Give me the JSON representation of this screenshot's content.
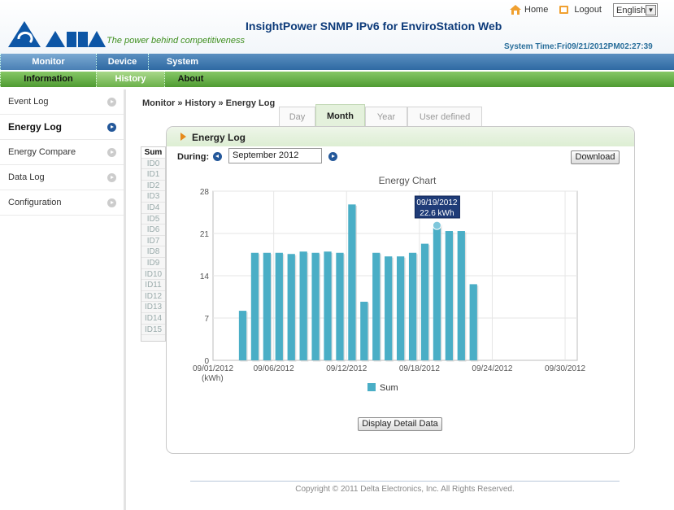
{
  "header": {
    "tagline": "The power behind competitiveness",
    "title": "InsightPower SNMP IPv6 for EnviroStation Web",
    "home_label": "Home",
    "logout_label": "Logout",
    "language": "English",
    "system_time": "System Time:Fri09/21/2012PM02:27:39",
    "brand_colors": {
      "blue": "#0d56a6",
      "green": "#3f8f1f"
    }
  },
  "nav_primary": [
    {
      "label": "Monitor",
      "active": true
    },
    {
      "label": "Device",
      "active": false
    },
    {
      "label": "System",
      "active": false
    }
  ],
  "nav_secondary": [
    {
      "label": "Information",
      "active": false
    },
    {
      "label": "History",
      "active": true
    },
    {
      "label": "About",
      "active": false
    }
  ],
  "sidebar": {
    "items": [
      {
        "label": "Event Log",
        "active": false
      },
      {
        "label": "Energy Log",
        "active": true
      },
      {
        "label": "Energy Compare",
        "active": false
      },
      {
        "label": "Data Log",
        "active": false
      },
      {
        "label": "Configuration",
        "active": false
      }
    ]
  },
  "breadcrumb": "Monitor » History » Energy Log",
  "tabs": [
    {
      "label": "Day",
      "active": false
    },
    {
      "label": "Month",
      "active": true
    },
    {
      "label": "Year",
      "active": false
    },
    {
      "label": "User defined",
      "active": false
    }
  ],
  "panel": {
    "title": "Energy Log",
    "during_label": "During:",
    "period_value": "September 2012",
    "download_label": "Download",
    "detail_button": "Display Detail Data"
  },
  "id_list": [
    "Sum",
    "ID0",
    "ID1",
    "ID2",
    "ID3",
    "ID4",
    "ID5",
    "ID6",
    "ID7",
    "ID8",
    "ID9",
    "ID10",
    "ID11",
    "ID12",
    "ID13",
    "ID14",
    "ID15"
  ],
  "chart_data": {
    "type": "bar",
    "title": "Energy Chart",
    "xlabel": "(kWh)",
    "x_ticks": [
      "09/01/2012",
      "09/06/2012",
      "09/12/2012",
      "09/18/2012",
      "09/24/2012",
      "09/30/2012"
    ],
    "y_ticks": [
      0,
      7,
      14,
      21,
      28
    ],
    "ylim": [
      0,
      28
    ],
    "xlim": [
      1,
      31
    ],
    "grid": true,
    "legend_position": "bottom",
    "bar_color": "#4aaec6",
    "series": [
      {
        "name": "Sum",
        "x": [
          3,
          4,
          5,
          6,
          7,
          8,
          9,
          10,
          11,
          12,
          13,
          14,
          15,
          16,
          17,
          18,
          19,
          20,
          21,
          22
        ],
        "values": [
          8.2,
          17.8,
          17.8,
          17.8,
          17.6,
          18,
          17.8,
          18,
          17.8,
          25.8,
          9.7,
          17.8,
          17.2,
          17.2,
          17.8,
          19.3,
          22.6,
          21.4,
          21.4,
          12.6
        ]
      }
    ],
    "tooltip": {
      "date": "09/19/2012",
      "value": "22.6 kWh"
    }
  },
  "footer": "Copyright © 2011 Delta Electronics, Inc. All Rights Reserved."
}
